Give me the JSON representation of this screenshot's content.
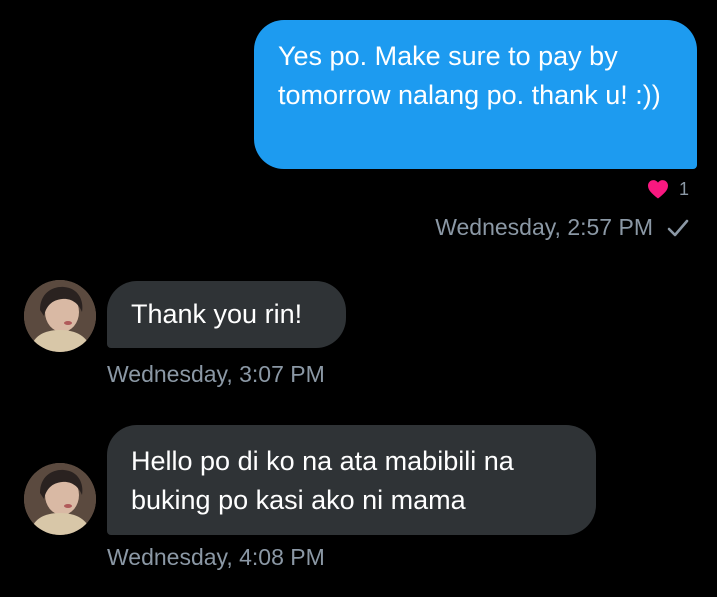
{
  "colors": {
    "background": "#000000",
    "outgoing_bubble": "#1d9bf0",
    "incoming_bubble": "#2f3336",
    "meta_text": "#8b98a5",
    "heart": "#f91880"
  },
  "messages": [
    {
      "direction": "outgoing",
      "text": "Yes po. Make sure to pay by tomorrow nalang po. thank u! :))",
      "reaction": {
        "icon": "heart-icon",
        "count": "1"
      },
      "timestamp": "Wednesday, 2:57 PM",
      "status_icon": "check-icon"
    },
    {
      "direction": "incoming",
      "avatar_icon": "avatar",
      "text": "Thank you rin!",
      "timestamp": "Wednesday, 3:07 PM"
    },
    {
      "direction": "incoming",
      "avatar_icon": "avatar",
      "text": "Hello po di ko na ata mabibili na buking po kasi ako ni mama",
      "timestamp": "Wednesday, 4:08 PM"
    }
  ]
}
